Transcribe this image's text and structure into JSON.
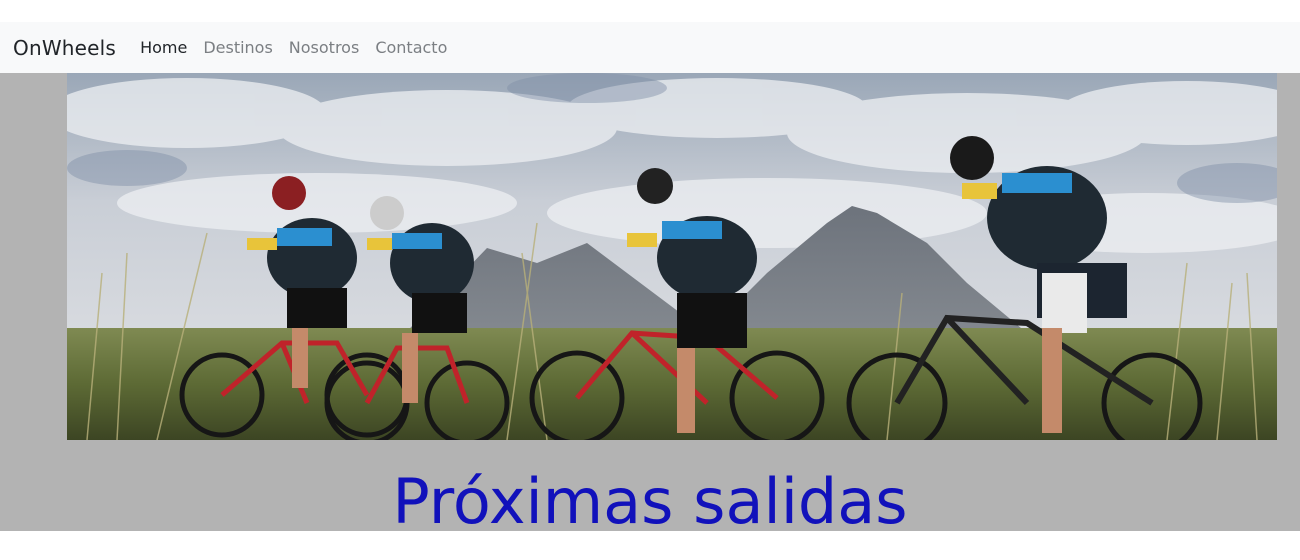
{
  "navbar": {
    "brand": "OnWheels",
    "links": [
      {
        "label": "Home",
        "active": true
      },
      {
        "label": "Destinos",
        "active": false
      },
      {
        "label": "Nosotros",
        "active": false
      },
      {
        "label": "Contacto",
        "active": false
      }
    ]
  },
  "hero": {
    "image_name": "cyclists-road-bikes-mountains-photo"
  },
  "main": {
    "section_title": "Próximas salidas"
  },
  "colors": {
    "navbar_bg": "#f8f9fa",
    "main_bg": "#b3b3b3",
    "title_color": "#1111bb",
    "link_muted": "#7b7f83",
    "link_active": "#212529"
  }
}
